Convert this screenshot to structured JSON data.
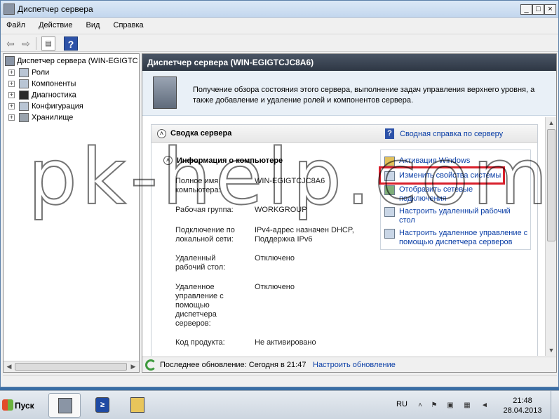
{
  "window": {
    "title": "Диспетчер сервера",
    "minimize": "_",
    "maximize": "□",
    "close": "×"
  },
  "menu": {
    "items": [
      "Файл",
      "Действие",
      "Вид",
      "Справка"
    ]
  },
  "toolbar": {
    "back": "⇦",
    "forward": "⇨",
    "help": "?"
  },
  "tree": {
    "root": "Диспетчер сервера (WIN-EGIGTC",
    "items": [
      {
        "label": "Роли",
        "icon": "roles-icon"
      },
      {
        "label": "Компоненты",
        "icon": "features-icon"
      },
      {
        "label": "Диагностика",
        "icon": "diagnostics-icon"
      },
      {
        "label": "Конфигурация",
        "icon": "configuration-icon"
      },
      {
        "label": "Хранилище",
        "icon": "storage-icon"
      }
    ],
    "expander": "+"
  },
  "main": {
    "header": "Диспетчер сервера (WIN-EGIGTCJC8A6)",
    "intro": "Получение обзора состояния этого сервера, выполнение задач управления верхнего уровня, а также добавление и удаление ролей и компонентов сервера.",
    "summary": {
      "title": "Сводка сервера",
      "help_link": "Сводная справка по серверу",
      "collapse": "˄",
      "computer_info": {
        "title": "Информация о компьютере",
        "rows": [
          {
            "label": "Полное имя компьютера:",
            "value": "WIN-EGIGTCJC8A6"
          },
          {
            "label": "Рабочая группа:",
            "value": "WORKGROUP"
          },
          {
            "label": "Подключение по локальной сети:",
            "value": "IPv4-адрес назначен DHCP, Поддержка IPv6"
          },
          {
            "label": "Удаленный рабочий стол:",
            "value": "Отключено"
          },
          {
            "label": "Удаленное управление с помощью диспетчера серверов:",
            "value": "Отключено"
          },
          {
            "label": "Код продукта:",
            "value": "Не активировано"
          }
        ]
      },
      "tasks": [
        {
          "label": "Активация Windows",
          "icon": "key-icon"
        },
        {
          "label": "Изменить свойства системы",
          "icon": "system-properties-icon"
        },
        {
          "label": "Отобразить сетевые подключения",
          "icon": "network-icon"
        },
        {
          "label": "Настроить удаленный рабочий стол",
          "icon": "remote-desktop-icon"
        },
        {
          "label": "Настроить удаленное управление с помощью диспетчера серверов",
          "icon": "remote-management-icon"
        }
      ]
    },
    "status": {
      "last_update": "Последнее обновление: Сегодня в 21:47",
      "configure_update": "Настроить обновление"
    }
  },
  "watermark": "pk-help.com",
  "taskbar": {
    "start": "Пуск",
    "lang": "RU",
    "time": "21:48",
    "date": "28.04.2013",
    "powershell_glyph": "≥"
  },
  "colors": {
    "link": "#0a3ea6",
    "highlight_box": "#d8202c",
    "header_bg": "#2e3744"
  }
}
